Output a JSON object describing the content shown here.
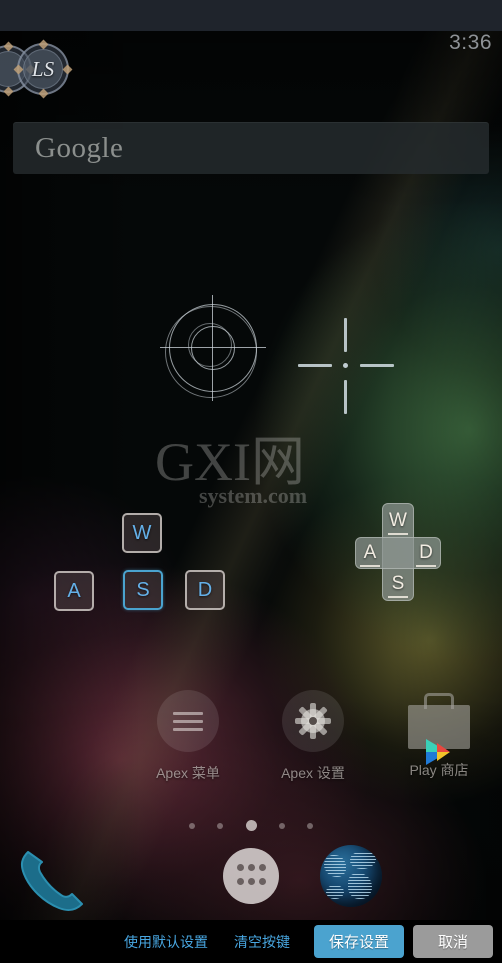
{
  "status_bar": {
    "time": "3:36"
  },
  "search_widget": {
    "label": "Google"
  },
  "joysticks": [
    {
      "name": "left-stick-partial",
      "label": ""
    },
    {
      "name": "left-stick",
      "label": "LS"
    }
  ],
  "watermark": {
    "main": "GXI网",
    "sub": "system.com"
  },
  "key_mappings": {
    "wasd_cluster": [
      {
        "key": "W",
        "selected": false
      },
      {
        "key": "A",
        "selected": false
      },
      {
        "key": "S",
        "selected": true
      },
      {
        "key": "D",
        "selected": false
      }
    ],
    "dpad": {
      "up": "W",
      "left": "A",
      "right": "D",
      "down": "S"
    }
  },
  "reticles": [
    {
      "name": "target-reticle",
      "style": "concentric-circles-crosshair"
    },
    {
      "name": "crosshair-reticle",
      "style": "plus-bars-center-dot"
    }
  ],
  "apps": [
    {
      "label": "Apex 菜单",
      "icon": "menu-icon"
    },
    {
      "label": "Apex 设置",
      "icon": "gear-icon"
    },
    {
      "label": "Play 商店",
      "icon": "play-store-icon"
    }
  ],
  "page_indicator": {
    "total": 5,
    "active_index": 2
  },
  "dock": [
    {
      "label": "",
      "icon": "phone-icon"
    },
    {
      "label": "",
      "icon": "app-drawer-icon"
    },
    {
      "label": "",
      "icon": "browser-globe-icon"
    }
  ],
  "action_bar": {
    "use_default": "使用默认设置",
    "clear_keys": "清空按键",
    "save": "保存设置",
    "cancel": "取消"
  },
  "colors": {
    "accent_blue": "#4ba3cf",
    "link_blue": "#48a6e0",
    "cancel_gray": "#9b9b9b",
    "key_text": "#64b0e8",
    "status_bar": "#1f242c"
  }
}
